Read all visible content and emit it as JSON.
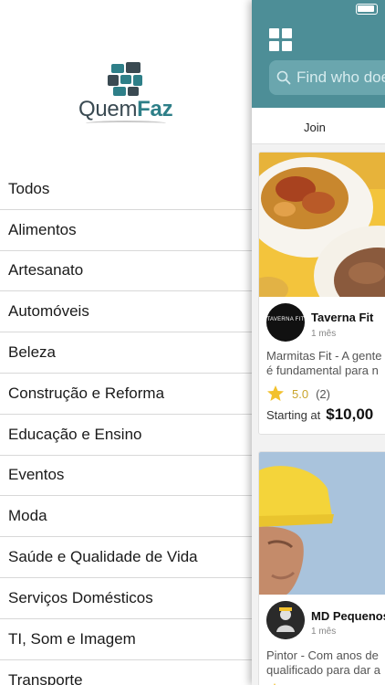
{
  "drawer": {
    "logo": {
      "text_part1": "Quem",
      "text_part2": "Faz"
    },
    "categories": [
      "Todos",
      "Alimentos",
      "Artesanato",
      "Automóveis",
      "Beleza",
      "Construção e Reforma",
      "Educação e Ensino",
      "Eventos",
      "Moda",
      "Saúde e Qualidade de Vida",
      "Serviços Domésticos",
      "TI, Som e Imagem",
      "Transporte"
    ]
  },
  "main": {
    "search": {
      "placeholder": "Find who does"
    },
    "tabs": {
      "join": "Join"
    },
    "cards": [
      {
        "name": "Taverna Fit",
        "time": "1 mês",
        "avatar_text": "TAVERNA FIT",
        "description_line1": "Marmitas Fit - A gente",
        "description_line2": "é fundamental para n",
        "rating": "5.0",
        "rating_count": "(2)",
        "starting_label": "Starting at",
        "price": "$10,00"
      },
      {
        "name": "MD Pequenos",
        "time": "1 mês",
        "description_line1": "Pintor - Com anos de",
        "description_line2": "qualificado para dar a"
      }
    ]
  },
  "colors": {
    "header_teal": "#4d8e97",
    "search_bg": "#6aa6ae",
    "star_gold": "#f2c12e",
    "logo_accent": "#2e7f88"
  },
  "icons": {
    "grid": "grid-icon",
    "search": "search-icon",
    "star": "star-icon",
    "battery": "battery-icon"
  }
}
